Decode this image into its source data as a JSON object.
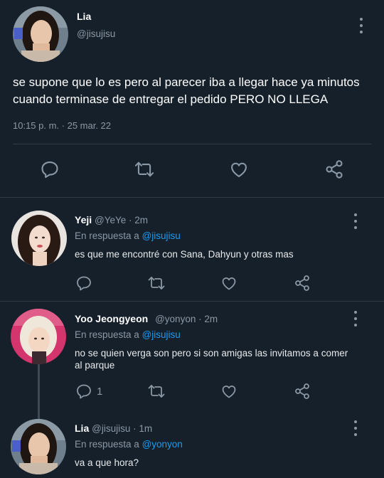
{
  "main_tweet": {
    "author_name": "Lia",
    "author_handle": "@jisujisu",
    "text_line1": "se supone que lo es pero al parecer iba a llegar hace ya minutos",
    "text_line2": "cuando terminase de entregar el pedido PERO NO LLEGA",
    "timestamp": "10:15 p. m. · 25 mar. 22"
  },
  "replies": [
    {
      "author_name": "Yeji",
      "author_meta": "@YeYe · 2m",
      "reply_prefix": "En respuesta a",
      "reply_to": "@jisujisu",
      "text_line1": "es que me encontré con Sana, Dahyun y otras mas",
      "text_line2": "",
      "reply_count": ""
    },
    {
      "author_name": "Yoo Jeongyeon",
      "author_meta": "@yonyon · 2m",
      "reply_prefix": "En respuesta a",
      "reply_to": "@jisujisu",
      "text_line1": "no se quien verga son pero si son amigas las invitamos a comer",
      "text_line2": "al parque",
      "reply_count": "1"
    },
    {
      "author_name": "Lia",
      "author_meta": "@jisujisu · 1m",
      "reply_prefix": "En respuesta a",
      "reply_to": "@yonyon",
      "text_line1": "va a que hora?",
      "text_line2": "",
      "reply_count": ""
    }
  ],
  "colors": {
    "background": "#15202b",
    "accent": "#1d9bf0",
    "muted": "#8b98a5",
    "divider": "#2f3b47"
  },
  "icons": [
    "comment-icon",
    "retweet-icon",
    "like-icon",
    "share-icon",
    "more-icon"
  ]
}
